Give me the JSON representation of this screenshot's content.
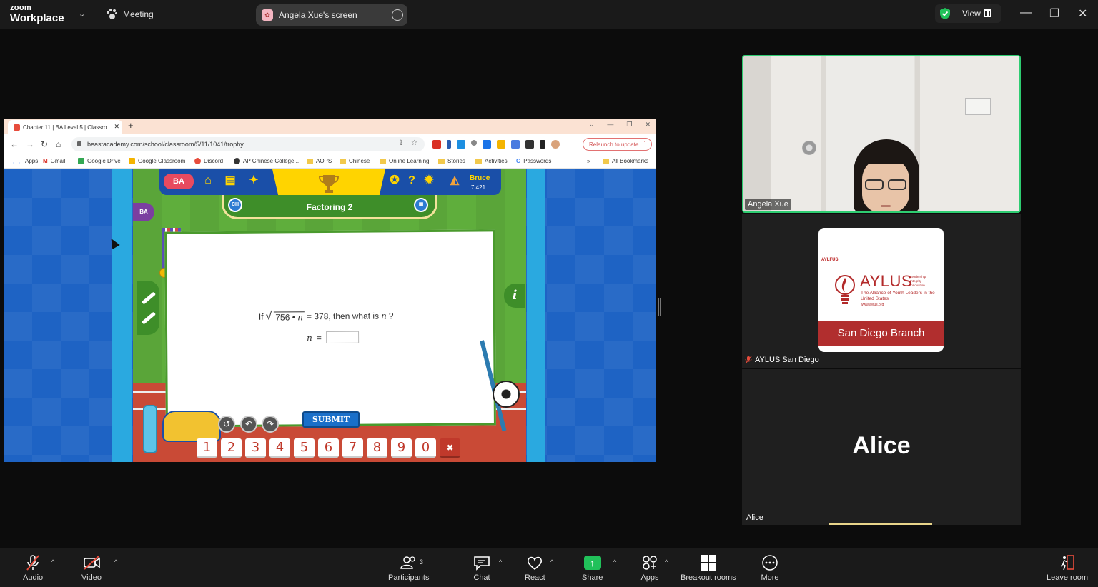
{
  "zoom": {
    "brand_top": "zoom",
    "brand_bottom": "Workplace",
    "meeting_label": "Meeting",
    "share_label": "Angela Xue's screen",
    "view_label": "View"
  },
  "browser": {
    "tab_title": "Chapter 11 | BA Level 5 | Classro",
    "url": "beastacademy.com/school/classroom/5/11/1041/trophy",
    "relaunch_label": "Relaunch to update",
    "bookmarks": [
      "Apps",
      "Gmail",
      "Google Drive",
      "Google Classroom",
      "Discord",
      "AP Chinese College...",
      "AOPS",
      "Chinese",
      "Online Learning",
      "Stories",
      "Activities",
      "Passwords"
    ],
    "all_bookmarks": "All Bookmarks"
  },
  "game": {
    "logo": "BA",
    "user_name": "Bruce",
    "user_points": "7,421",
    "badge": "BA",
    "lesson_title": "Factoring 2",
    "chapter_btn": "CH",
    "question_prefix": "If",
    "radicand_number": "756",
    "radicand_dot": "•",
    "radicand_var": "n",
    "question_middle": "= 378, then what is",
    "question_var": "n",
    "question_end": "?",
    "answer_var": "n",
    "answer_eq": "=",
    "submit_label": "SUBMIT",
    "keys": [
      "1",
      "2",
      "3",
      "4",
      "5",
      "6",
      "7",
      "8",
      "9",
      "0"
    ],
    "delete_key": "✖",
    "info": "i"
  },
  "participants": {
    "angela": "Angela Xue",
    "aylus": {
      "name": "AYLUS San Diego",
      "small_label": "AYLFUS",
      "title": "AYLUS",
      "tagline": [
        "Leadership",
        "Integrity",
        "Innovation"
      ],
      "subtitle": "The Alliance of Youth Leaders in the United States",
      "website": "www.aylus.org",
      "branch": "San Diego Branch"
    },
    "alice": {
      "big_name": "Alice",
      "name": "Alice"
    }
  },
  "controls": {
    "audio": "Audio",
    "video": "Video",
    "participants": "Participants",
    "participants_count": "3",
    "chat": "Chat",
    "react": "React",
    "share": "Share",
    "apps": "Apps",
    "breakout": "Breakout rooms",
    "more": "More",
    "leave": "Leave room"
  },
  "colors": {
    "accent_green": "#2ecc71",
    "share_green": "#21c15a",
    "aylus_red": "#b12e2e"
  }
}
